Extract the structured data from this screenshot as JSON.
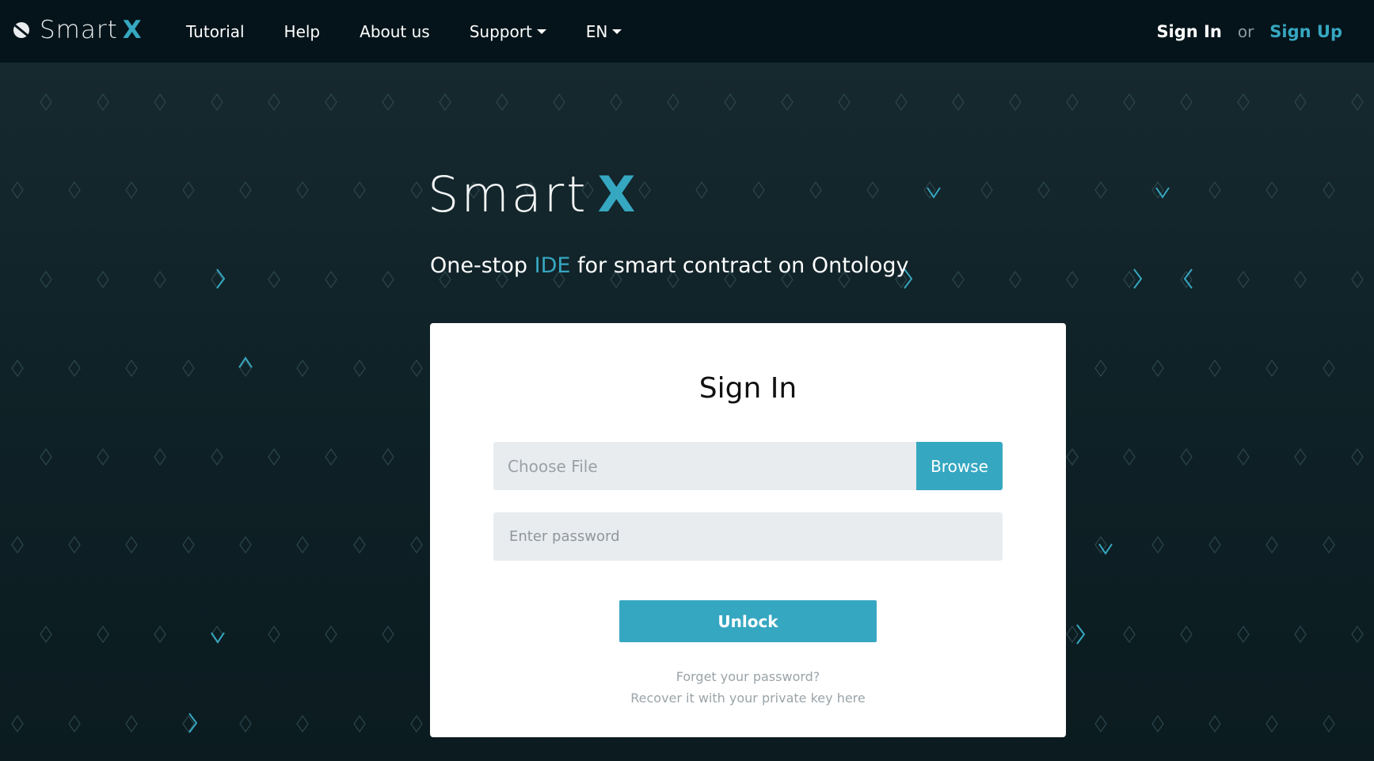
{
  "nav": {
    "brand_text": "Smart",
    "brand_x": "X",
    "links": [
      "Tutorial",
      "Help",
      "About us",
      "Support",
      "EN"
    ],
    "signin": "Sign In",
    "or": "or",
    "signup": "Sign Up"
  },
  "hero": {
    "logo_text": "Smart",
    "logo_x": "X",
    "tagline_before": "One-stop ",
    "tagline_highlight": "IDE",
    "tagline_after": " for smart contract on Ontology"
  },
  "card": {
    "title": "Sign In",
    "file_placeholder": "Choose File",
    "browse_label": "Browse",
    "password_placeholder": "Enter password",
    "unlock_label": "Unlock",
    "forget_text": "Forget your password?",
    "recover_text": "Recover it with your private key here"
  },
  "colors": {
    "accent": "#36a7c1",
    "navbar_bg": "#05141a",
    "hero_bg": "#0f2227",
    "card_bg": "#ffffff",
    "input_bg": "#e9ecef"
  }
}
